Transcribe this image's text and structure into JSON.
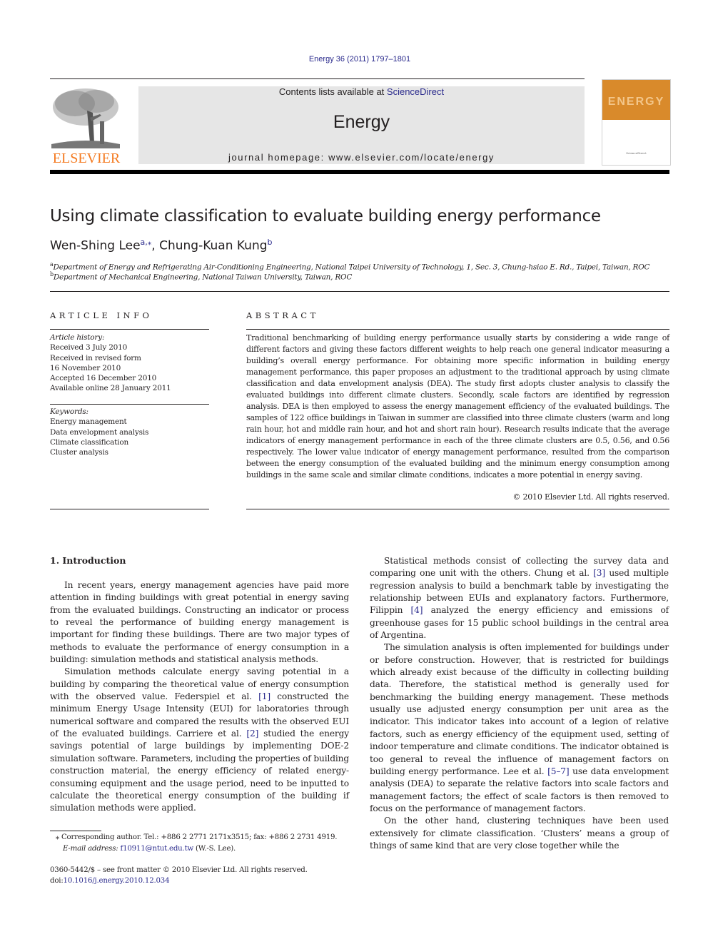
{
  "header": {
    "journal_ref": "Energy 36 (2011) 1797–1801",
    "contents_prefix": "Contents lists available at ",
    "contents_link": "ScienceDirect",
    "journal_name": "Energy",
    "homepage_prefix": "journal homepage: ",
    "homepage_url": "www.elsevier.com/locate/energy",
    "publisher_logo_text": "ELSEVIER",
    "cover_word": "ENERGY",
    "publisher_color": "#f47a20",
    "cover_color": "#d98a2b"
  },
  "article": {
    "title": "Using climate classification to evaluate building energy performance",
    "authors": [
      {
        "name": "Wen-Shing Lee",
        "aff": "a,⁎"
      },
      {
        "name": "Chung-Kuan Kung",
        "aff": "b"
      }
    ],
    "author_separator": ", ",
    "affiliations": [
      {
        "mark": "a",
        "text": "Department of Energy and Refrigerating Air-Conditioning Engineering, National Taipei University of Technology, 1, Sec. 3, Chung-hsiao E. Rd., Taipei, Taiwan, ROC"
      },
      {
        "mark": "b",
        "text": "Department of Mechanical Engineering, National Taiwan University, Taiwan, ROC"
      }
    ]
  },
  "article_info": {
    "heading": "ARTICLE INFO",
    "history_label": "Article history:",
    "history": [
      "Received 3 July 2010",
      "Received in revised form",
      "16 November 2010",
      "Accepted 16 December 2010",
      "Available online 28 January 2011"
    ],
    "keywords_label": "Keywords:",
    "keywords": [
      "Energy management",
      "Data envelopment analysis",
      "Climate classification",
      "Cluster analysis"
    ]
  },
  "abstract": {
    "heading": "ABSTRACT",
    "text": "Traditional benchmarking of building energy performance usually starts by considering a wide range of different factors and giving these factors different weights to help reach one general indicator measuring a building’s overall energy performance. For obtaining more specific information in building energy management performance, this paper proposes an adjustment to the traditional approach by using climate classification and data envelopment analysis (DEA). The study first adopts cluster analysis to classify the evaluated buildings into different climate clusters. Secondly, scale factors are identified by regression analysis. DEA is then employed to assess the energy management efficiency of the evaluated buildings. The samples of 122 office buildings in Taiwan in summer are classified into three climate clusters (warm and long rain hour, hot and middle rain hour, and hot and short rain hour). Research results indicate that the average indicators of energy management performance in each of the three climate clusters are 0.5, 0.56, and 0.56 respectively. The lower value indicator of energy management performance, resulted from the comparison between the energy consumption of the evaluated building and the minimum energy consumption among buildings in the same scale and similar climate conditions, indicates a more potential in energy saving.",
    "copyright": "© 2010 Elsevier Ltd. All rights reserved."
  },
  "body": {
    "section_heading": "1.  Introduction",
    "left_paragraphs": [
      {
        "parts": [
          {
            "t": "In recent years, energy management agencies have paid more attention in finding buildings with great potential in energy saving from the evaluated buildings. Constructing an indicator or process to reveal the performance of building energy management is important for finding these buildings. There are two major types of methods to evaluate the performance of energy consumption in a building: simulation methods and statistical analysis methods."
          }
        ]
      },
      {
        "parts": [
          {
            "t": "Simulation methods calculate energy saving potential in a building by comparing the theoretical value of energy consumption with the observed value. Federspiel et al. "
          },
          {
            "ref": "[1]"
          },
          {
            "t": " con­structed the minimum Energy Usage Intensity (EUI) for laboratories through numerical software and compared the results with the observed EUI of the evaluated buildings. Carriere et al. "
          },
          {
            "ref": "[2]"
          },
          {
            "t": " studied the energy savings potential of large buildings by implementing DOE-2 simulation software. Parameters, including the properties of building construction material, the energy efficiency of related energy-consuming equipment and the usage period, need to be inputted to calculate the theoretical energy consumption of the building if simulation methods were applied."
          }
        ]
      }
    ],
    "right_paragraphs": [
      {
        "parts": [
          {
            "t": "Statistical methods consist of collecting the survey data and comparing one unit with the others. Chung et al. "
          },
          {
            "ref": "[3]"
          },
          {
            "t": " used multiple regression analysis to build a benchmark table by investigating the relationship between EUIs and explanatory factors. Furthermore, Filippin "
          },
          {
            "ref": "[4]"
          },
          {
            "t": " analyzed the energy efficiency and emissions of greenhouse gases for 15 public school buildings in the central area of Argentina."
          }
        ]
      },
      {
        "parts": [
          {
            "t": "The simulation analysis is often implemented for buildings under or before construction. However, that is restricted for buildings which already exist because of the difficulty in collecting building data. Therefore, the statistical method is generally used for benchmarking the building energy management. These methods usually use adjusted energy consumption per unit area as the indicator. This indicator takes into account of a legion of relative factors, such as energy efficiency of the equipment used, setting of indoor temperature and climate conditions. The indicator obtained is too general to reveal the influence of management factors on building energy performance. Lee et al. "
          },
          {
            "ref": "[5–7]"
          },
          {
            "t": " use data envelop­ment analysis (DEA) to separate the relative factors into scale factors and management factors; the effect of scale factors is then removed to focus on the performance of management factors."
          }
        ]
      },
      {
        "parts": [
          {
            "t": "On the other hand, clustering techniques have been used extensively for climate classification. ‘Clusters’ means a group of things of same kind that are very close together while the"
          }
        ]
      }
    ]
  },
  "footnote": {
    "star": "⁎",
    "corresponding": "Corresponding author. Tel.: +886 2 2771 2171x3515; fax: +886 2 2731 4919.",
    "email_label": "E-mail address: ",
    "email": "f10911@ntut.edu.tw",
    "email_suffix": " (W.-S. Lee)."
  },
  "front_matter": {
    "issn_line": "0360-5442/$ – see front matter © 2010 Elsevier Ltd. All rights reserved.",
    "doi_label": "doi:",
    "doi": "10.1016/j.energy.2010.12.034"
  }
}
